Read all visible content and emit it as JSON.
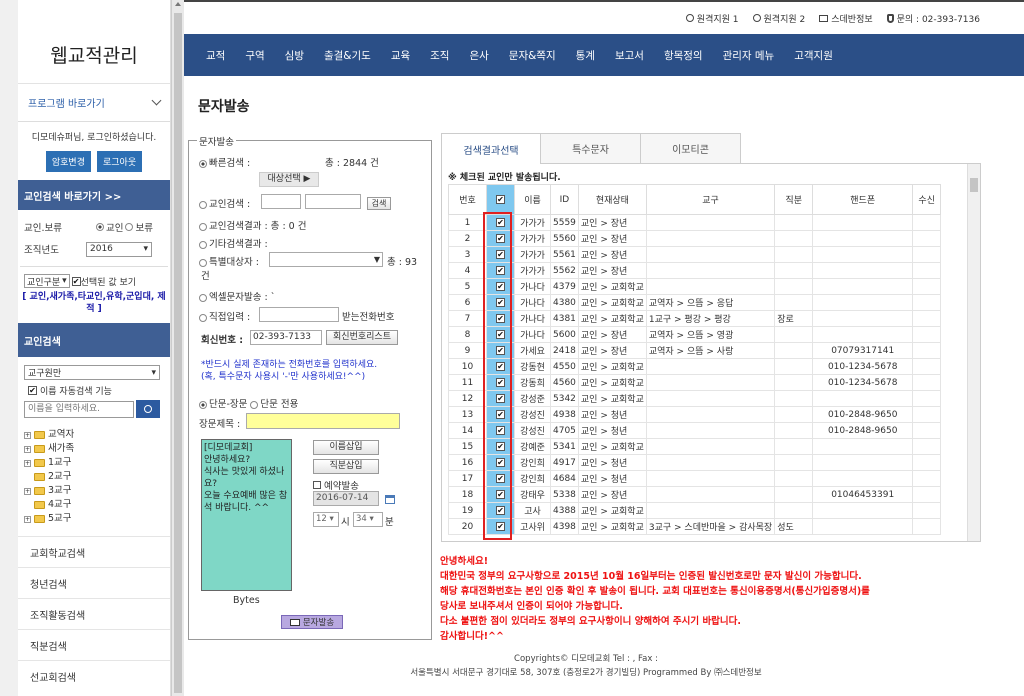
{
  "brand": {
    "title": "웹교적관리"
  },
  "program_shortcut": "프로그램 바로가기",
  "greeting": "디모데슈퍼님, 로그인하셨습니다.",
  "buttons": {
    "pw_change": "암호변경",
    "logout": "로그아웃"
  },
  "sidebar": {
    "member_shortcut": "교인검색 바로가기 >>",
    "member_type_label": "교인.보류",
    "member_radio": "교인",
    "hold_radio": "보류",
    "org_year_label": "조직년도",
    "org_year": "2016",
    "category_select": "교인구분",
    "selected_view": "선택된 값 보기",
    "category_links": "[ 교인,새가족,타교인,유학,군입대, 제적 ]",
    "member_search": "교인검색",
    "district_select": "교구원만",
    "auto_search": "이름 자동검색 기능",
    "name_placeholder": "이름을 입력하세요.",
    "tree": [
      "교역자",
      "새가족",
      "1교구",
      "2교구",
      "3교구",
      "4교구",
      "5교구"
    ],
    "links": [
      "교회학교검색",
      "청년검색",
      "조직활동검색",
      "직분검색",
      "선교회검색"
    ]
  },
  "topbar": {
    "remote1": "원격지원 1",
    "remote2": "원격지원 2",
    "company": "스데반정보",
    "inquiry": "문의 : 02-393-7136"
  },
  "nav": [
    "교적",
    "구역",
    "심방",
    "출결&기도",
    "교육",
    "조직",
    "은사",
    "문자&쪽지",
    "통계",
    "보고서",
    "항목정의",
    "관리자 메뉴",
    "고객지원"
  ],
  "page_title": "문자발송",
  "form": {
    "legend": "문자발송",
    "quick": "빠른검색 :",
    "quick_total": "총 : 2844 건",
    "target_select": "대상선택",
    "member_search": "교인검색 :",
    "search_btn": "검색",
    "member_result": "교인검색결과 : 총 : 0 건",
    "other_result": "기타검색결과 :",
    "special_target": "특별대상자 :",
    "special_total": "총 : 93",
    "special_unit": "건",
    "excel": "엑셀문자발송 : `",
    "direct": "직접입력 :",
    "receive_no": "받는전화번호",
    "reply_label": "회신번호 :",
    "reply_value": "02-393-7133",
    "reply_list_btn": "회신번호리스트",
    "note1": "*반드시 실제 존재하는 전화번호를 입력하세요.",
    "note2": "(혹, 특수문자 사용시 '-'만 사용하세요!^^)",
    "long_short": "단문-장문",
    "short_only": "단문 전용",
    "subject_label": "장문제목 :",
    "message": "[디모데교회]\n안녕하세요?\n식사는 맛있게 하셨나요?\n오늘 수요예배 많은 참석 바랍니다. ^^",
    "insert_name": "이름삽입",
    "insert_title": "직분삽입",
    "reserve": "예약발송",
    "reserve_date": "2016-07-14",
    "hour": "12",
    "hour_unit": "시",
    "minute": "34",
    "minute_unit": "분",
    "bytes": "Bytes",
    "send": "문자발송"
  },
  "tabs": [
    "검색결과선택",
    "특수문자",
    "이모티콘"
  ],
  "table": {
    "note": "※ 체크된 교인만 발송됩니다.",
    "headers": [
      "번호",
      "",
      "이름",
      "ID",
      "현재상태",
      "교구",
      "직분",
      "핸드폰",
      "수신"
    ],
    "rows": [
      [
        "1",
        "가가가",
        "5559",
        "교인 > 장년",
        "",
        "",
        ""
      ],
      [
        "2",
        "가가가",
        "5560",
        "교인 > 장년",
        "",
        "",
        ""
      ],
      [
        "3",
        "가가가",
        "5561",
        "교인 > 장년",
        "",
        "",
        ""
      ],
      [
        "4",
        "가가가",
        "5562",
        "교인 > 장년",
        "",
        "",
        ""
      ],
      [
        "5",
        "가나다",
        "4379",
        "교인 > 교회학교",
        "",
        "",
        ""
      ],
      [
        "6",
        "가나다",
        "4380",
        "교인 > 교회학교",
        "교역자 > 으뜸 > 응답",
        "",
        ""
      ],
      [
        "7",
        "가나다",
        "4381",
        "교인 > 교회학교",
        "1교구 > 평강 > 평강",
        "장로",
        ""
      ],
      [
        "8",
        "가나다",
        "5600",
        "교인 > 장년",
        "교역자 > 으뜸 > 영광",
        "",
        ""
      ],
      [
        "9",
        "가세요",
        "2418",
        "교인 > 장년",
        "교역자 > 으뜸 > 사랑",
        "",
        "07079317141"
      ],
      [
        "10",
        "강동현",
        "4550",
        "교인 > 교회학교",
        "",
        "",
        "010-1234-5678"
      ],
      [
        "11",
        "강동희",
        "4560",
        "교인 > 교회학교",
        "",
        "",
        "010-1234-5678"
      ],
      [
        "12",
        "강성준",
        "5342",
        "교인 > 교회학교",
        "",
        "",
        ""
      ],
      [
        "13",
        "강성진",
        "4938",
        "교인 > 청년",
        "",
        "",
        "010-2848-9650"
      ],
      [
        "14",
        "강성진",
        "4705",
        "교인 > 청년",
        "",
        "",
        "010-2848-9650"
      ],
      [
        "15",
        "강예준",
        "5341",
        "교인 > 교회학교",
        "",
        "",
        ""
      ],
      [
        "16",
        "강인희",
        "4917",
        "교인 > 청년",
        "",
        "",
        ""
      ],
      [
        "17",
        "강인희",
        "4684",
        "교인 > 청년",
        "",
        "",
        ""
      ],
      [
        "18",
        "강태우",
        "5338",
        "교인 > 장년",
        "",
        "",
        "01046453391"
      ],
      [
        "19",
        "고사",
        "4388",
        "교인 > 교회학교",
        "",
        "",
        ""
      ],
      [
        "20",
        "고사위",
        "4398",
        "교인 > 교회학교",
        "3교구 > 스데반마을 > 감사목장",
        "성도",
        ""
      ]
    ]
  },
  "warning": [
    "안녕하세요!",
    "대한민국 정부의 요구사항으로 2015년 10월 16일부터는 인증된 발신번호로만 문자 발신이 가능합니다.",
    "해당 휴대전화번호는 본인 인증 확인 후 발송이 됩니다. 교회 대표번호는 통신이용증명서(통신가입증명서)를",
    "당사로 보내주셔서 인증이 되어야 가능합니다.",
    "다소 불편한 점이 있더라도 정부의 요구사항이니 양해하여 주시기 바랍니다.",
    "감사합니다!^^"
  ],
  "footer": {
    "line1": "Copyrights© 디모데교회 Tel : , Fax :",
    "line2": "서울특별시 서대문구 경기대로 58, 307호 (충정로2가 경기빌딩) Programmed By ㈜스데반정보"
  }
}
